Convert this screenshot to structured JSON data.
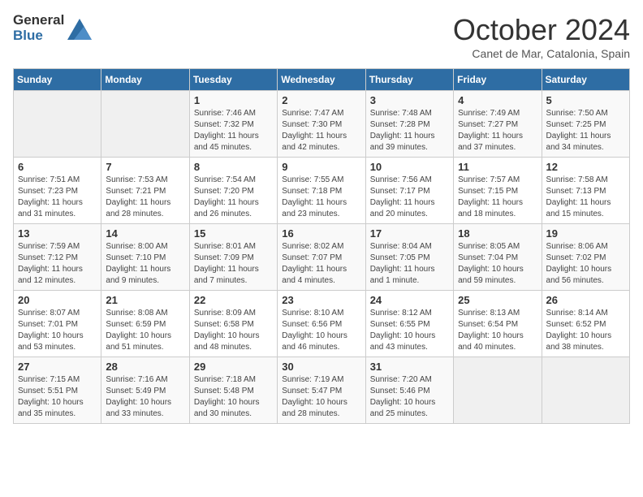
{
  "header": {
    "logo_general": "General",
    "logo_blue": "Blue",
    "month_title": "October 2024",
    "subtitle": "Canet de Mar, Catalonia, Spain"
  },
  "days_of_week": [
    "Sunday",
    "Monday",
    "Tuesday",
    "Wednesday",
    "Thursday",
    "Friday",
    "Saturday"
  ],
  "weeks": [
    [
      {
        "day": "",
        "info": ""
      },
      {
        "day": "",
        "info": ""
      },
      {
        "day": "1",
        "info": "Sunrise: 7:46 AM\nSunset: 7:32 PM\nDaylight: 11 hours and 45 minutes."
      },
      {
        "day": "2",
        "info": "Sunrise: 7:47 AM\nSunset: 7:30 PM\nDaylight: 11 hours and 42 minutes."
      },
      {
        "day": "3",
        "info": "Sunrise: 7:48 AM\nSunset: 7:28 PM\nDaylight: 11 hours and 39 minutes."
      },
      {
        "day": "4",
        "info": "Sunrise: 7:49 AM\nSunset: 7:27 PM\nDaylight: 11 hours and 37 minutes."
      },
      {
        "day": "5",
        "info": "Sunrise: 7:50 AM\nSunset: 7:25 PM\nDaylight: 11 hours and 34 minutes."
      }
    ],
    [
      {
        "day": "6",
        "info": "Sunrise: 7:51 AM\nSunset: 7:23 PM\nDaylight: 11 hours and 31 minutes."
      },
      {
        "day": "7",
        "info": "Sunrise: 7:53 AM\nSunset: 7:21 PM\nDaylight: 11 hours and 28 minutes."
      },
      {
        "day": "8",
        "info": "Sunrise: 7:54 AM\nSunset: 7:20 PM\nDaylight: 11 hours and 26 minutes."
      },
      {
        "day": "9",
        "info": "Sunrise: 7:55 AM\nSunset: 7:18 PM\nDaylight: 11 hours and 23 minutes."
      },
      {
        "day": "10",
        "info": "Sunrise: 7:56 AM\nSunset: 7:17 PM\nDaylight: 11 hours and 20 minutes."
      },
      {
        "day": "11",
        "info": "Sunrise: 7:57 AM\nSunset: 7:15 PM\nDaylight: 11 hours and 18 minutes."
      },
      {
        "day": "12",
        "info": "Sunrise: 7:58 AM\nSunset: 7:13 PM\nDaylight: 11 hours and 15 minutes."
      }
    ],
    [
      {
        "day": "13",
        "info": "Sunrise: 7:59 AM\nSunset: 7:12 PM\nDaylight: 11 hours and 12 minutes."
      },
      {
        "day": "14",
        "info": "Sunrise: 8:00 AM\nSunset: 7:10 PM\nDaylight: 11 hours and 9 minutes."
      },
      {
        "day": "15",
        "info": "Sunrise: 8:01 AM\nSunset: 7:09 PM\nDaylight: 11 hours and 7 minutes."
      },
      {
        "day": "16",
        "info": "Sunrise: 8:02 AM\nSunset: 7:07 PM\nDaylight: 11 hours and 4 minutes."
      },
      {
        "day": "17",
        "info": "Sunrise: 8:04 AM\nSunset: 7:05 PM\nDaylight: 11 hours and 1 minute."
      },
      {
        "day": "18",
        "info": "Sunrise: 8:05 AM\nSunset: 7:04 PM\nDaylight: 10 hours and 59 minutes."
      },
      {
        "day": "19",
        "info": "Sunrise: 8:06 AM\nSunset: 7:02 PM\nDaylight: 10 hours and 56 minutes."
      }
    ],
    [
      {
        "day": "20",
        "info": "Sunrise: 8:07 AM\nSunset: 7:01 PM\nDaylight: 10 hours and 53 minutes."
      },
      {
        "day": "21",
        "info": "Sunrise: 8:08 AM\nSunset: 6:59 PM\nDaylight: 10 hours and 51 minutes."
      },
      {
        "day": "22",
        "info": "Sunrise: 8:09 AM\nSunset: 6:58 PM\nDaylight: 10 hours and 48 minutes."
      },
      {
        "day": "23",
        "info": "Sunrise: 8:10 AM\nSunset: 6:56 PM\nDaylight: 10 hours and 46 minutes."
      },
      {
        "day": "24",
        "info": "Sunrise: 8:12 AM\nSunset: 6:55 PM\nDaylight: 10 hours and 43 minutes."
      },
      {
        "day": "25",
        "info": "Sunrise: 8:13 AM\nSunset: 6:54 PM\nDaylight: 10 hours and 40 minutes."
      },
      {
        "day": "26",
        "info": "Sunrise: 8:14 AM\nSunset: 6:52 PM\nDaylight: 10 hours and 38 minutes."
      }
    ],
    [
      {
        "day": "27",
        "info": "Sunrise: 7:15 AM\nSunset: 5:51 PM\nDaylight: 10 hours and 35 minutes."
      },
      {
        "day": "28",
        "info": "Sunrise: 7:16 AM\nSunset: 5:49 PM\nDaylight: 10 hours and 33 minutes."
      },
      {
        "day": "29",
        "info": "Sunrise: 7:18 AM\nSunset: 5:48 PM\nDaylight: 10 hours and 30 minutes."
      },
      {
        "day": "30",
        "info": "Sunrise: 7:19 AM\nSunset: 5:47 PM\nDaylight: 10 hours and 28 minutes."
      },
      {
        "day": "31",
        "info": "Sunrise: 7:20 AM\nSunset: 5:46 PM\nDaylight: 10 hours and 25 minutes."
      },
      {
        "day": "",
        "info": ""
      },
      {
        "day": "",
        "info": ""
      }
    ]
  ]
}
